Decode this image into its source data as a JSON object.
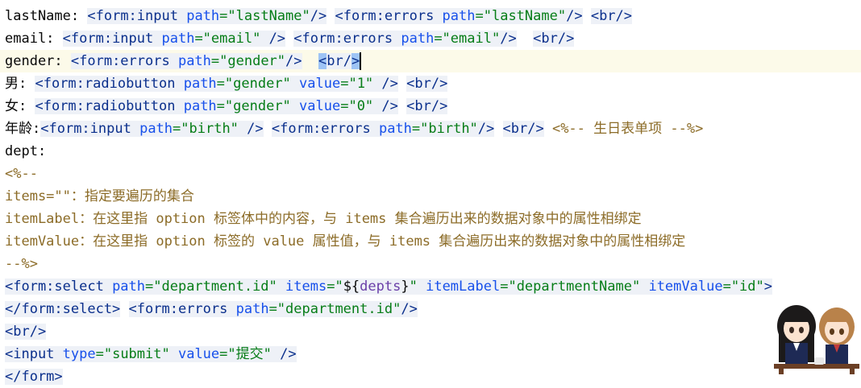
{
  "code_lines": [
    {
      "current": false,
      "tokens": [
        {
          "text": "lastName: ",
          "cls": "c-plain"
        },
        {
          "text": "<",
          "cls": "c-tagname",
          "tag": true
        },
        {
          "text": "form:input",
          "cls": "c-tagname",
          "tag": true
        },
        {
          "text": " path",
          "cls": "c-attr",
          "tag": true
        },
        {
          "text": "=\"lastName\"",
          "cls": "c-str",
          "tag": true
        },
        {
          "text": "/>",
          "cls": "c-tagname",
          "tag": true
        },
        {
          "text": " ",
          "cls": "c-plain"
        },
        {
          "text": "<form:errors",
          "cls": "c-tagname",
          "tag": true
        },
        {
          "text": " path",
          "cls": "c-attr",
          "tag": true
        },
        {
          "text": "=\"lastName\"",
          "cls": "c-str",
          "tag": true
        },
        {
          "text": "/>",
          "cls": "c-tagname",
          "tag": true
        },
        {
          "text": " ",
          "cls": "c-plain"
        },
        {
          "text": "<br/>",
          "cls": "c-tagname",
          "tag": true
        }
      ]
    },
    {
      "current": false,
      "tokens": [
        {
          "text": "email: ",
          "cls": "c-plain"
        },
        {
          "text": "<form:input",
          "cls": "c-tagname",
          "tag": true
        },
        {
          "text": " path",
          "cls": "c-attr",
          "tag": true
        },
        {
          "text": "=\"email\"",
          "cls": "c-str",
          "tag": true
        },
        {
          "text": " />",
          "cls": "c-tagname",
          "tag": true
        },
        {
          "text": " ",
          "cls": "c-plain"
        },
        {
          "text": "<form:errors",
          "cls": "c-tagname",
          "tag": true
        },
        {
          "text": " path",
          "cls": "c-attr",
          "tag": true
        },
        {
          "text": "=\"email\"",
          "cls": "c-str",
          "tag": true
        },
        {
          "text": "/>",
          "cls": "c-tagname",
          "tag": true
        },
        {
          "text": "  ",
          "cls": "c-plain"
        },
        {
          "text": "<br/>",
          "cls": "c-tagname",
          "tag": true
        }
      ]
    },
    {
      "current": true,
      "tokens": [
        {
          "text": "gender: ",
          "cls": "c-plain"
        },
        {
          "text": "<form:errors",
          "cls": "c-tagname",
          "tag": true
        },
        {
          "text": " path",
          "cls": "c-attr",
          "tag": true
        },
        {
          "text": "=\"gender\"",
          "cls": "c-str",
          "tag": true
        },
        {
          "text": "/>",
          "cls": "c-tagname",
          "tag": true
        },
        {
          "text": "  ",
          "cls": "c-plain"
        },
        {
          "text": "<",
          "cls": "c-tagname",
          "tag": true,
          "sel": true
        },
        {
          "text": "br/",
          "cls": "c-tagname",
          "tag": true
        },
        {
          "text": ">",
          "cls": "c-tagname",
          "tag": true,
          "sel": true
        },
        {
          "cursor": true
        }
      ]
    },
    {
      "current": false,
      "tokens": [
        {
          "text": "男: ",
          "cls": "c-plain"
        },
        {
          "text": "<form:radiobutton",
          "cls": "c-tagname",
          "tag": true
        },
        {
          "text": " path",
          "cls": "c-attr",
          "tag": true
        },
        {
          "text": "=\"gender\"",
          "cls": "c-str",
          "tag": true
        },
        {
          "text": " value",
          "cls": "c-attr",
          "tag": true
        },
        {
          "text": "=\"1\"",
          "cls": "c-str",
          "tag": true
        },
        {
          "text": " />",
          "cls": "c-tagname",
          "tag": true
        },
        {
          "text": " ",
          "cls": "c-plain"
        },
        {
          "text": "<br/>",
          "cls": "c-tagname",
          "tag": true
        }
      ]
    },
    {
      "current": false,
      "tokens": [
        {
          "text": "女: ",
          "cls": "c-plain"
        },
        {
          "text": "<form:radiobutton",
          "cls": "c-tagname",
          "tag": true
        },
        {
          "text": " path",
          "cls": "c-attr",
          "tag": true
        },
        {
          "text": "=\"gender\"",
          "cls": "c-str",
          "tag": true
        },
        {
          "text": " value",
          "cls": "c-attr",
          "tag": true
        },
        {
          "text": "=\"0\"",
          "cls": "c-str",
          "tag": true
        },
        {
          "text": " />",
          "cls": "c-tagname",
          "tag": true
        },
        {
          "text": " ",
          "cls": "c-plain"
        },
        {
          "text": "<br/>",
          "cls": "c-tagname",
          "tag": true
        }
      ]
    },
    {
      "current": false,
      "tokens": [
        {
          "text": "年龄:",
          "cls": "c-plain"
        },
        {
          "text": "<form:input",
          "cls": "c-tagname",
          "tag": true
        },
        {
          "text": " path",
          "cls": "c-attr",
          "tag": true
        },
        {
          "text": "=\"birth\"",
          "cls": "c-str",
          "tag": true
        },
        {
          "text": " />",
          "cls": "c-tagname",
          "tag": true
        },
        {
          "text": " ",
          "cls": "c-plain"
        },
        {
          "text": "<form:errors",
          "cls": "c-tagname",
          "tag": true
        },
        {
          "text": " path",
          "cls": "c-attr",
          "tag": true
        },
        {
          "text": "=\"birth\"",
          "cls": "c-str",
          "tag": true
        },
        {
          "text": "/>",
          "cls": "c-tagname",
          "tag": true
        },
        {
          "text": " ",
          "cls": "c-plain"
        },
        {
          "text": "<br/>",
          "cls": "c-tagname",
          "tag": true
        },
        {
          "text": " <%-- 生日表单项 --%>",
          "cls": "c-comment"
        }
      ]
    },
    {
      "current": false,
      "tokens": [
        {
          "text": "dept:",
          "cls": "c-plain"
        }
      ]
    },
    {
      "current": false,
      "tokens": [
        {
          "text": "<%--",
          "cls": "c-comment"
        }
      ]
    },
    {
      "current": false,
      "tokens": [
        {
          "text": "items=\"\"：指定要遍历的集合",
          "cls": "c-comment"
        }
      ]
    },
    {
      "current": false,
      "tokens": [
        {
          "text": "itemLabel：在这里指 option 标签体中的内容，与 items 集合遍历出来的数据对象中的属性相绑定",
          "cls": "c-comment"
        }
      ]
    },
    {
      "current": false,
      "tokens": [
        {
          "text": "itemValue：在这里指 option 标签的 value 属性值，与 items 集合遍历出来的数据对象中的属性相绑定",
          "cls": "c-comment"
        }
      ]
    },
    {
      "current": false,
      "tokens": [
        {
          "text": "--%>",
          "cls": "c-comment"
        }
      ]
    },
    {
      "current": false,
      "tokens": [
        {
          "text": "<form:select",
          "cls": "c-tagname",
          "tag": true
        },
        {
          "text": " path",
          "cls": "c-attr",
          "tag": true
        },
        {
          "text": "=\"department.id\"",
          "cls": "c-str",
          "tag": true
        },
        {
          "text": " items",
          "cls": "c-attr",
          "tag": true
        },
        {
          "text": "=\"",
          "cls": "c-str",
          "tag": true
        },
        {
          "text": "${",
          "cls": "c-plain",
          "tag": true
        },
        {
          "text": "depts",
          "cls": "c-el",
          "tag": true
        },
        {
          "text": "}",
          "cls": "c-plain",
          "tag": true
        },
        {
          "text": "\"",
          "cls": "c-str",
          "tag": true
        },
        {
          "text": " itemLabel",
          "cls": "c-attr",
          "tag": true
        },
        {
          "text": "=\"departmentName\"",
          "cls": "c-str",
          "tag": true
        },
        {
          "text": " itemValue",
          "cls": "c-attr",
          "tag": true
        },
        {
          "text": "=\"id\"",
          "cls": "c-str",
          "tag": true
        },
        {
          "text": ">",
          "cls": "c-tagname",
          "tag": true
        }
      ]
    },
    {
      "current": false,
      "tokens": [
        {
          "text": "</form:select>",
          "cls": "c-tagname",
          "tag": true
        },
        {
          "text": " ",
          "cls": "c-plain"
        },
        {
          "text": "<form:errors",
          "cls": "c-tagname",
          "tag": true
        },
        {
          "text": " path",
          "cls": "c-attr",
          "tag": true
        },
        {
          "text": "=\"department.id\"",
          "cls": "c-str",
          "tag": true
        },
        {
          "text": "/>",
          "cls": "c-tagname",
          "tag": true
        }
      ]
    },
    {
      "current": false,
      "tokens": [
        {
          "text": "<br/>",
          "cls": "c-tagname",
          "tag": true
        }
      ]
    },
    {
      "current": false,
      "tokens": [
        {
          "text": "<input",
          "cls": "c-tagname",
          "tag": true
        },
        {
          "text": " type",
          "cls": "c-attr",
          "tag": true
        },
        {
          "text": "=\"submit\"",
          "cls": "c-str",
          "tag": true
        },
        {
          "text": " value",
          "cls": "c-attr",
          "tag": true
        },
        {
          "text": "=\"提交\"",
          "cls": "c-str",
          "tag": true
        },
        {
          "text": " />",
          "cls": "c-tagname",
          "tag": true
        }
      ]
    },
    {
      "current": false,
      "tokens": [
        {
          "text": "</form>",
          "cls": "c-tagname",
          "tag": true
        }
      ]
    }
  ],
  "mascot_icon": "anime-girls-mascot-icon"
}
